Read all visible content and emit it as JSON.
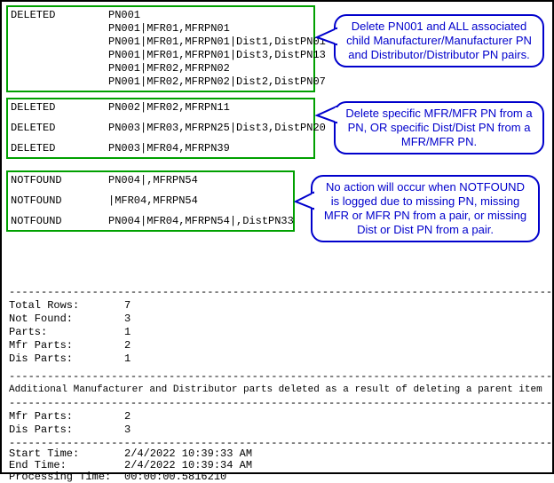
{
  "section1": {
    "status": "DELETED",
    "r1": "PN001",
    "r2": "PN001|MFR01,MFRPN01",
    "r3": "PN001|MFR01,MFRPN01|Dist1,DistPN01",
    "r4": "PN001|MFR01,MFRPN01|Dist3,DistPN13",
    "r5": "PN001|MFR02,MFRPN02",
    "r6": "PN001|MFR02,MFRPN02|Dist2,DistPN07"
  },
  "section2": {
    "status": "DELETED",
    "r1": "PN002|MFR02,MFRPN11",
    "r2": "PN003|MFR03,MFRPN25|Dist3,DistPN20",
    "r3": "PN003|MFR04,MFRPN39"
  },
  "section3": {
    "status": "NOTFOUND",
    "r1": "PN004|,MFRPN54",
    "r2": "|MFR04,MFRPN54",
    "r3": "PN004|MFR04,MFRPN54|,DistPN33"
  },
  "callout1": {
    "l1": "Delete PN001 and ALL associated",
    "l2": "child Manufacturer/Manufacturer PN",
    "l3": "and Distributor/Distributor PN pairs."
  },
  "callout2": {
    "l1": "Delete specific MFR/MFR PN from a",
    "l2": "PN, OR specific Dist/Dist PN from a",
    "l3": "MFR/MFR PN."
  },
  "callout3": {
    "l1": "No action will occur when NOTFOUND",
    "l2": "is logged due to missing PN, missing",
    "l3": "MFR or MFR PN from a pair, or missing",
    "l4": "Dist or Dist PN from a pair."
  },
  "dash": "-------------------------------------------------------------------------------------",
  "summary": {
    "total_rows_label": "Total Rows:",
    "total_rows": "7",
    "not_found_label": "Not Found:",
    "not_found": "3",
    "parts_label": "Parts:",
    "parts": "1",
    "mfr_parts_label": "Mfr Parts:",
    "mfr_parts": "2",
    "dis_parts_label": "Dis Parts:",
    "dis_parts": "1"
  },
  "additional_msg": "Additional Manufacturer and Distributor parts deleted as a result of deleting a parent item",
  "summary2": {
    "mfr_parts_label": "Mfr Parts:",
    "mfr_parts": "2",
    "dis_parts_label": "Dis Parts:",
    "dis_parts": "3"
  },
  "timing": {
    "start_label": "Start Time:",
    "start": "2/4/2022 10:39:33 AM",
    "end_label": "End Time:",
    "end": "2/4/2022 10:39:34 AM",
    "proc_label": "Processing Time:",
    "proc": "00:00:00.5816210"
  }
}
